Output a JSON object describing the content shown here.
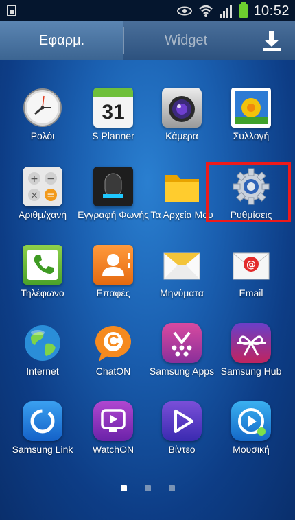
{
  "status": {
    "time": "10:52"
  },
  "tabs": {
    "apps": "Εφαρμ.",
    "widget": "Widget"
  },
  "apps": [
    {
      "label": "Ρολόι",
      "icon": "clock-icon"
    },
    {
      "label": "S Planner",
      "icon": "calendar-icon",
      "badge": "31"
    },
    {
      "label": "Κάμερα",
      "icon": "camera-icon"
    },
    {
      "label": "Συλλογή",
      "icon": "gallery-icon"
    },
    {
      "label": "Αριθμ/χανή",
      "icon": "calculator-icon"
    },
    {
      "label": "Εγγραφή Φωνής",
      "icon": "voice-recorder-icon"
    },
    {
      "label": "Τα Αρχεία Μου",
      "icon": "folder-icon"
    },
    {
      "label": "Ρυθμίσεις",
      "icon": "settings-gear-icon"
    },
    {
      "label": "Τηλέφωνο",
      "icon": "phone-icon"
    },
    {
      "label": "Επαφές",
      "icon": "contacts-icon"
    },
    {
      "label": "Μηνύματα",
      "icon": "messages-icon"
    },
    {
      "label": "Email",
      "icon": "email-icon"
    },
    {
      "label": "Internet",
      "icon": "globe-icon"
    },
    {
      "label": "ChatON",
      "icon": "chaton-icon",
      "badge": "C"
    },
    {
      "label": "Samsung Apps",
      "icon": "samsung-apps-icon"
    },
    {
      "label": "Samsung Hub",
      "icon": "samsung-hub-icon"
    },
    {
      "label": "Samsung Link",
      "icon": "samsung-link-icon"
    },
    {
      "label": "WatchON",
      "icon": "watchon-icon"
    },
    {
      "label": "Βίντεο",
      "icon": "video-icon"
    },
    {
      "label": "Μουσική",
      "icon": "music-icon"
    }
  ],
  "pager": {
    "pages": 3,
    "current": 1
  }
}
